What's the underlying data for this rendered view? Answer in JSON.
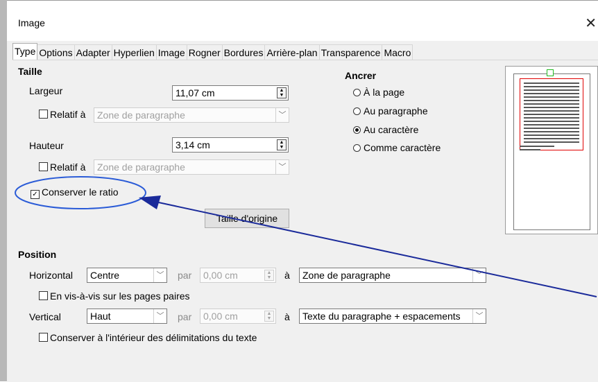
{
  "dialog": {
    "title": "Image",
    "close_icon": "close-icon"
  },
  "tabs": [
    "Type",
    "Options",
    "Adapter",
    "Hyperlien",
    "Image",
    "Rogner",
    "Bordures",
    "Arrière-plan",
    "Transparence",
    "Macro"
  ],
  "taille": {
    "heading": "Taille",
    "largeur_label": "Largeur",
    "largeur_value": "11,07 cm",
    "relatif_label": "Relatif à",
    "relatif_placeholder": "Zone de paragraphe",
    "hauteur_label": "Hauteur",
    "hauteur_value": "3,14 cm",
    "relatif2_label": "Relatif à",
    "relatif2_placeholder": "Zone de paragraphe",
    "keep_ratio_label": "Conserver le ratio",
    "original_size_label": "Taille d'origine"
  },
  "ancrer": {
    "heading": "Ancrer",
    "options": [
      "À la page",
      "Au paragraphe",
      "Au caractère",
      "Comme caractère"
    ],
    "selected": "Au caractère"
  },
  "position": {
    "heading": "Position",
    "horizontal_label": "Horizontal",
    "horizontal_value": "Centre",
    "par_label": "par",
    "h_par_value": "0,00 cm",
    "a_label": "à",
    "h_to_value": "Zone de paragraphe",
    "mirror_label": "En vis-à-vis sur les pages paires",
    "vertical_label": "Vertical",
    "vertical_value": "Haut",
    "v_par_value": "0,00 cm",
    "v_to_value": "Texte du paragraphe + espacements",
    "keep_inside_label": "Conserver à l'intérieur des délimitations du texte"
  },
  "colors": {
    "annotation": "#1a2a9a",
    "highlight_ellipse": "#2a5bd7",
    "anchor_frame": "#e00000",
    "anchor_marker": "#22bb22"
  }
}
